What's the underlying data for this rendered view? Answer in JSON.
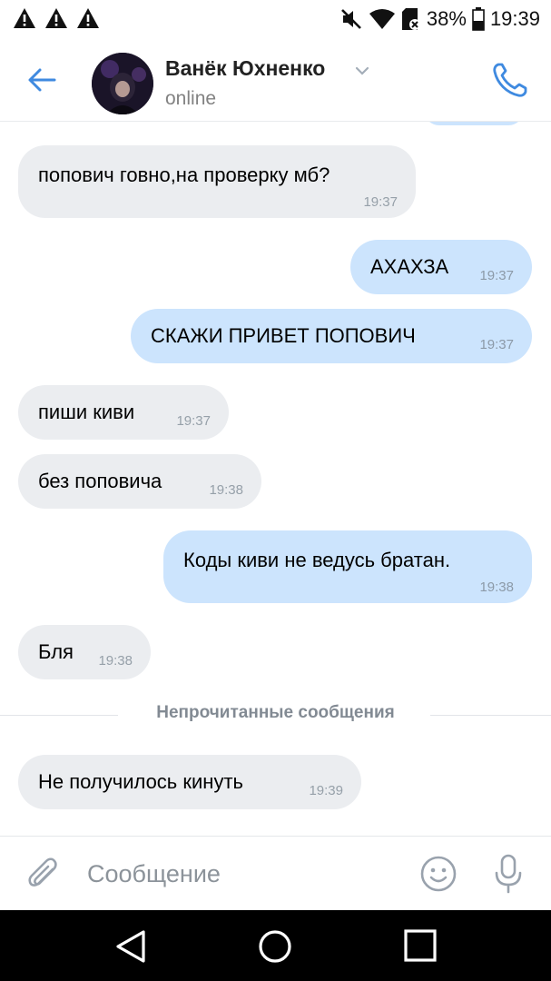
{
  "status_bar": {
    "battery": "38%",
    "time": "19:39",
    "icons": [
      "warning-icon",
      "warning-icon",
      "warning-icon",
      "mute-icon",
      "wifi-icon",
      "sd-card-icon",
      "battery-icon"
    ]
  },
  "header": {
    "contact_name": "Ванёк Юхненко",
    "contact_status": "online"
  },
  "messages": [
    {
      "direction": "in",
      "text": "попович говно,на проверку мб?",
      "time": "19:37"
    },
    {
      "direction": "out",
      "text": "АХАХЗА",
      "time": "19:37"
    },
    {
      "direction": "out",
      "text": "СКАЖИ ПРИВЕТ ПОПОВИЧ",
      "time": "19:37"
    },
    {
      "direction": "in",
      "text": "пиши киви",
      "time": "19:37"
    },
    {
      "direction": "in",
      "text": "без поповича",
      "time": "19:38"
    },
    {
      "direction": "out",
      "text": "Коды киви не ведусь братан.",
      "time": "19:38"
    },
    {
      "direction": "in",
      "text": "Бля",
      "time": "19:38"
    }
  ],
  "unread_divider": "Непрочитанные сообщения",
  "unread_messages": [
    {
      "direction": "in",
      "text": "Не получилось кинуть",
      "time": "19:39"
    }
  ],
  "composer": {
    "placeholder": "Сообщение"
  },
  "colors": {
    "accent": "#3f8ae0",
    "incoming_bubble": "#ebedf0",
    "outgoing_bubble": "#cce4fd"
  }
}
